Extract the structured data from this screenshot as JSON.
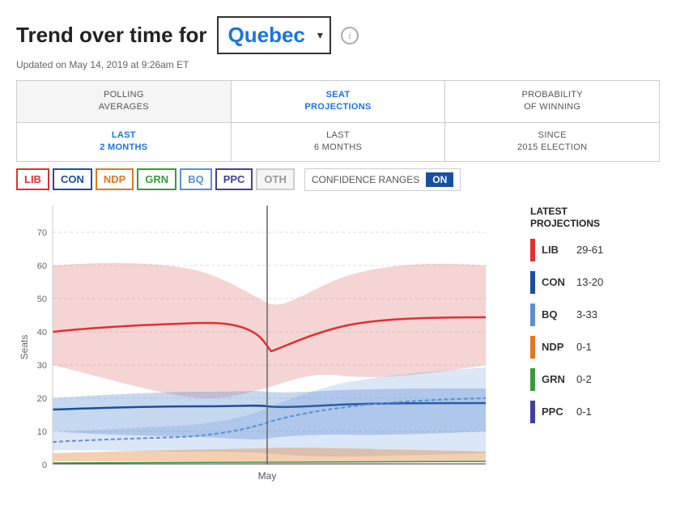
{
  "header": {
    "title_prefix": "Trend over time for",
    "dropdown_value": "Quebec",
    "info_icon_label": "i",
    "updated_text": "Updated on May 14, 2019 at 9:26am ET"
  },
  "tabs_outer": [
    {
      "label": "POLLING\nAVERAGES",
      "active": false
    },
    {
      "label": "SEAT\nPROJECTIONS",
      "active": true
    },
    {
      "label": "PROBABILITY\nOF WINNING",
      "active": false
    }
  ],
  "tabs_inner": [
    {
      "label": "LAST\n2 MONTHS",
      "active": true
    },
    {
      "label": "LAST\n6 MONTHS",
      "active": false
    },
    {
      "label": "SINCE\n2015 ELECTION",
      "active": false
    }
  ],
  "party_buttons": [
    {
      "id": "lib",
      "label": "LIB",
      "class": "lib"
    },
    {
      "id": "con",
      "label": "CON",
      "class": "con"
    },
    {
      "id": "ndp",
      "label": "NDP",
      "class": "ndp"
    },
    {
      "id": "grn",
      "label": "GRN",
      "class": "grn"
    },
    {
      "id": "bq",
      "label": "BQ",
      "class": "bq"
    },
    {
      "id": "ppc",
      "label": "PPC",
      "class": "ppc"
    },
    {
      "id": "oth",
      "label": "OTH",
      "class": "oth"
    }
  ],
  "confidence_toggle": {
    "label": "CONFIDENCE RANGES",
    "state": "ON"
  },
  "chart": {
    "y_axis_label": "Seats",
    "y_ticks": [
      0,
      10,
      20,
      30,
      40,
      50,
      60,
      70
    ],
    "x_label": "May",
    "colors": {
      "lib": "#e03030",
      "lib_band": "rgba(220,100,100,0.25)",
      "con": "#1a4fa0",
      "con_band": "rgba(100,130,200,0.25)",
      "bq": "#5b8fd4",
      "bq_band": "rgba(91,143,212,0.2)",
      "ndp": "#e07820",
      "ndp_band": "rgba(224,120,32,0.2)",
      "grn": "#3a9a3a",
      "grn_band": "rgba(58,154,58,0.2)",
      "ppc": "#4040a0",
      "ppc_band": "rgba(64,64,160,0.15)"
    }
  },
  "legend": {
    "title": "LATEST\nPROJECTIONS",
    "items": [
      {
        "party": "LIB",
        "range": "29-61",
        "color": "#e03030"
      },
      {
        "party": "CON",
        "range": "13-20",
        "color": "#1a4fa0"
      },
      {
        "party": "BQ",
        "range": "3-33",
        "color": "#5b8fd4"
      },
      {
        "party": "NDP",
        "range": "0-1",
        "color": "#e07820"
      },
      {
        "party": "GRN",
        "range": "0-2",
        "color": "#3a9a3a"
      },
      {
        "party": "PPC",
        "range": "0-1",
        "color": "#4040a0"
      }
    ]
  }
}
